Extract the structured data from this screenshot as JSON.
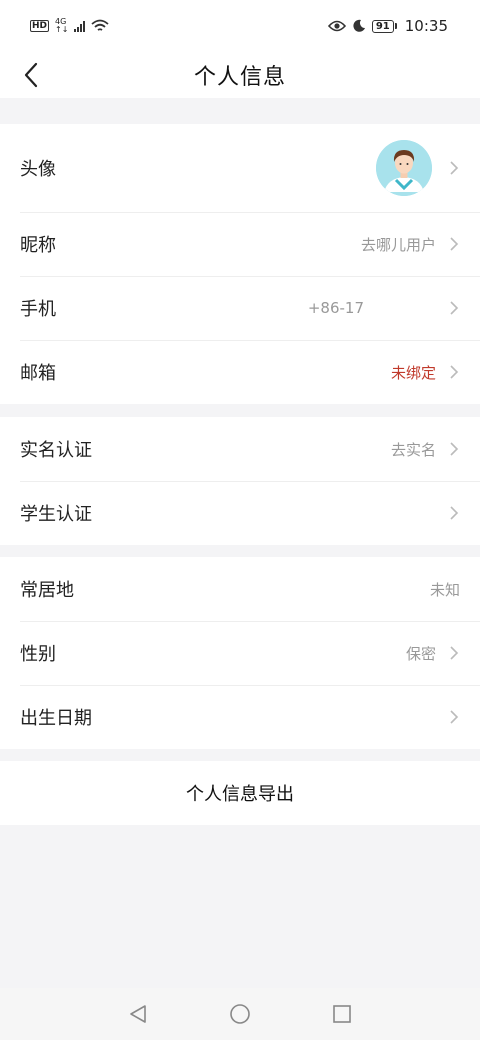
{
  "status_bar": {
    "hd": "HD",
    "network_top": "4G",
    "network_bottom": "↑↓",
    "battery": "91",
    "time": "10:35",
    "icons": [
      "hd-icon",
      "signal-icon",
      "wifi-icon",
      "eye-icon",
      "moon-icon",
      "battery-icon"
    ]
  },
  "header": {
    "title": "个人信息",
    "back_icon": "chevron-left-icon"
  },
  "profile_group": {
    "avatar_label": "头像",
    "nickname_label": "昵称",
    "nickname_value": "去哪儿用户",
    "phone_label": "手机",
    "phone_value": "+86-17",
    "email_label": "邮箱",
    "email_value": "未绑定"
  },
  "verify_group": {
    "realname_label": "实名认证",
    "realname_value": "去实名",
    "student_label": "学生认证",
    "student_value": ""
  },
  "info_group": {
    "residence_label": "常居地",
    "residence_value": "未知",
    "gender_label": "性别",
    "gender_value": "保密",
    "birthday_label": "出生日期",
    "birthday_value": ""
  },
  "export": {
    "label": "个人信息导出"
  },
  "colors": {
    "background": "#f4f4f6",
    "card": "#ffffff",
    "warn": "#c0392b",
    "muted": "#999999",
    "avatar_bg": "#a8e2ec"
  }
}
